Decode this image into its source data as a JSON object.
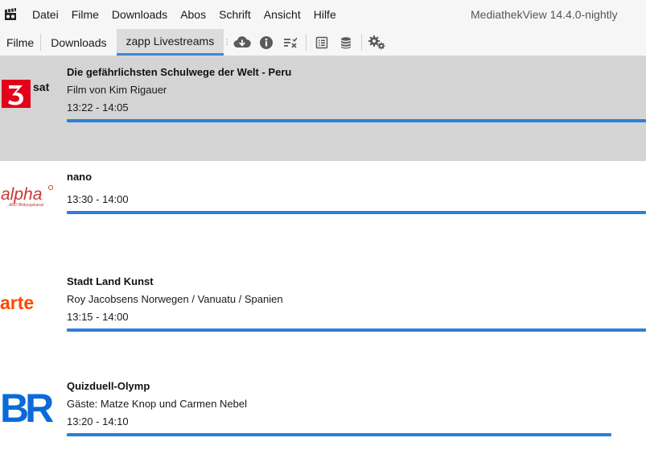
{
  "app": {
    "window_title": "MediathekView 14.4.0-nightly"
  },
  "menu": [
    "Datei",
    "Filme",
    "Downloads",
    "Abos",
    "Schrift",
    "Ansicht",
    "Hilfe"
  ],
  "tabs": [
    "Filme",
    "Downloads",
    "zapp Livestreams"
  ],
  "toolbar_icons": [
    "download-cloud-icon",
    "info-icon",
    "clear-list-icon",
    "description-icon",
    "database-icon",
    "settings-gears-icon"
  ],
  "streams": [
    {
      "channel": "3sat",
      "logo_text": "sat",
      "title": "Die gefährlichsten Schulwege der Welt - Peru",
      "subtitle": "Film von Kim Rigauer",
      "time": "13:22 - 14:05",
      "progress": 1.0,
      "selected": true
    },
    {
      "channel": "alpha",
      "logo_text": "alpha",
      "logo_subtext": "ARD Bildungskanal",
      "title": "nano",
      "subtitle": "",
      "time": "13:30 - 14:00",
      "progress": 1.0,
      "selected": false
    },
    {
      "channel": "arte",
      "logo_text": "arte",
      "title": "Stadt Land Kunst",
      "subtitle": "Roy Jacobsens Norwegen / Vanuatu / Spanien",
      "time": "13:15 - 14:00",
      "progress": 1.0,
      "selected": false
    },
    {
      "channel": "BR",
      "logo_text": "BR",
      "title": "Quizduell-Olymp",
      "subtitle": "Gäste: Matze Knop und Carmen Nebel",
      "time": "13:20 - 14:10",
      "progress": 0.94,
      "selected": false
    }
  ],
  "colors": {
    "accent": "#2e7fd6",
    "selected_row": "#d4d4d4",
    "3sat_red": "#e2001a",
    "arte_orange": "#fd4600",
    "alpha_red": "#c8372d",
    "br_blue": "#0a6bd8"
  }
}
